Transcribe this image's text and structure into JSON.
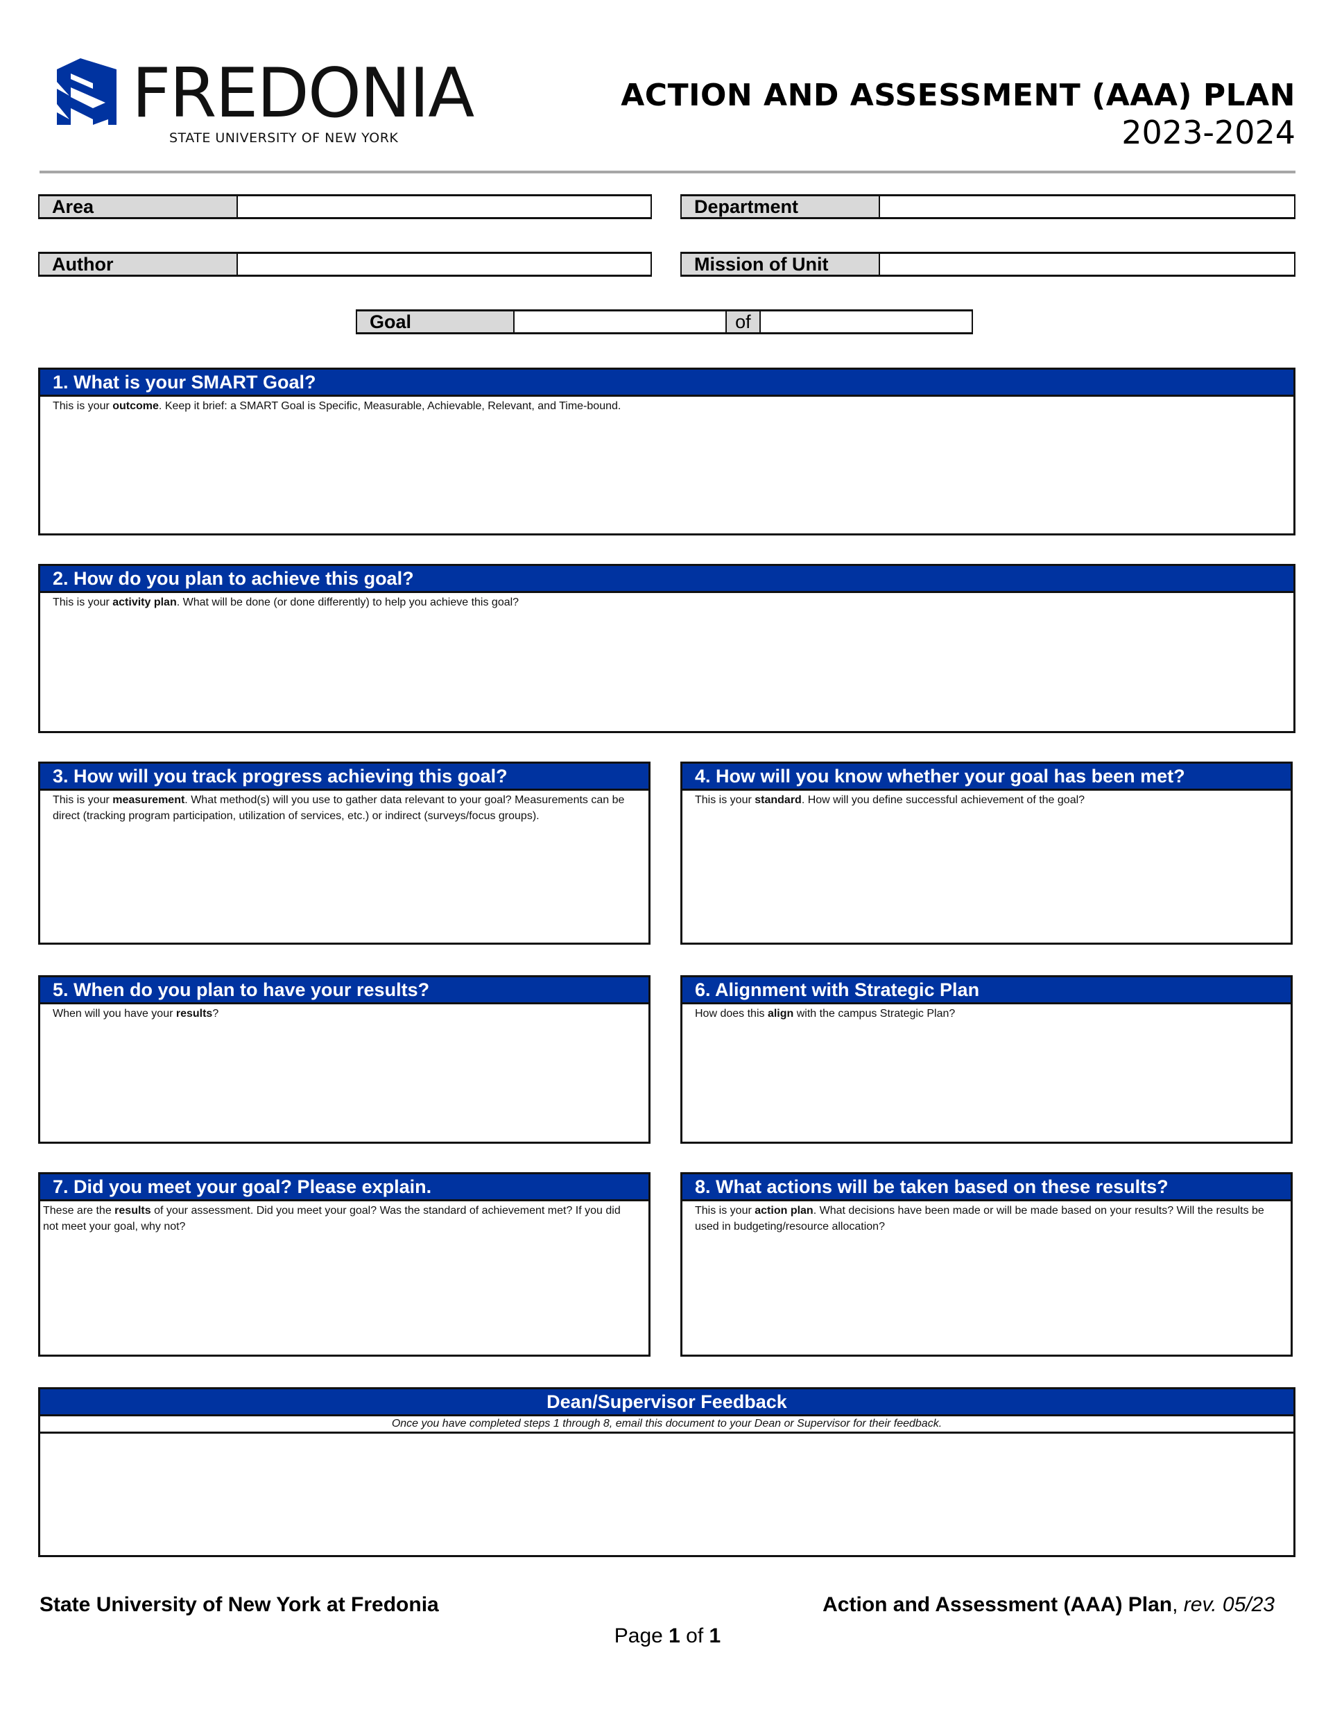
{
  "header": {
    "logo_word": "FREDONIA",
    "logo_subtitle": "STATE UNIVERSITY OF NEW YORK",
    "title": "ACTION AND ASSESSMENT (AAA) PLAN",
    "year": "2023-2024",
    "brand_color": "#0033a0"
  },
  "fields": {
    "area": {
      "label": "Area",
      "value": ""
    },
    "department": {
      "label": "Department",
      "value": ""
    },
    "author": {
      "label": "Author",
      "value": ""
    },
    "mission": {
      "label": "Mission of Unit",
      "value": ""
    },
    "goal": {
      "label": "Goal",
      "value": "",
      "of_label": "of",
      "of_value": ""
    }
  },
  "sections": [
    {
      "title": "1. What is your SMART Goal?",
      "hint_pre": "This is your ",
      "hint_bold": "outcome",
      "hint_post": ". Keep it brief: a SMART Goal is Specific, Measurable, Achievable, Relevant, and Time-bound.",
      "value": ""
    },
    {
      "title": "2. How do you plan to achieve this goal?",
      "hint_pre": "This is your ",
      "hint_bold": "activity plan",
      "hint_post": ". What will be done (or done differently) to help you achieve this goal?",
      "value": ""
    },
    {
      "title": "3. How will you track progress achieving this goal?",
      "hint_pre": "This is your ",
      "hint_bold": "measurement",
      "hint_post": ". What method(s) will you use to gather data relevant to your goal? Measurements can be direct (tracking program participation, utilization of services, etc.) or indirect (surveys/focus groups).",
      "value": ""
    },
    {
      "title": "4. How will you know whether your goal has been met?",
      "hint_pre": "This is your ",
      "hint_bold": "standard",
      "hint_post": ". How will you define successful achievement of the goal?",
      "value": ""
    },
    {
      "title": "5. When do you plan to have your results?",
      "hint_pre": "When will you have your ",
      "hint_bold": "results",
      "hint_post": "?",
      "value": ""
    },
    {
      "title": "6. Alignment with Strategic Plan",
      "hint_pre": "How does this ",
      "hint_bold": "align",
      "hint_post": " with the campus Strategic Plan?",
      "value": ""
    },
    {
      "title": "7. Did you meet your goal? Please explain.",
      "hint_pre": "These are the ",
      "hint_bold": "results",
      "hint_post": " of your assessment. Did you meet your goal? Was the standard of achievement met? If you did not meet your goal, why not?",
      "value": ""
    },
    {
      "title": "8. What actions will be taken based on these results?",
      "hint_pre": "This is your ",
      "hint_bold": "action plan",
      "hint_post": ". What decisions have been made or will be made based on your results? Will the results be used in budgeting/resource allocation?",
      "value": ""
    }
  ],
  "feedback": {
    "title": "Dean/Supervisor Feedback",
    "hint": "Once you have completed steps 1 through 8, email this document to your Dean or Supervisor for their feedback.",
    "value": ""
  },
  "footer": {
    "left": "State University of New York at Fredonia",
    "right_bold": "Action and Assessment (AAA) Plan",
    "right_sep": ", ",
    "right_italic": "rev. 05/23",
    "page_prefix": "Page ",
    "page_current": "1",
    "page_of": " of ",
    "page_total": "1"
  }
}
